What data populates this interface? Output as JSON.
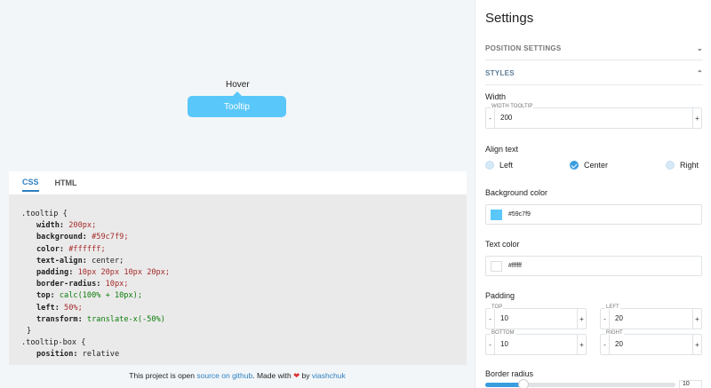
{
  "preview": {
    "hover_label": "Hover",
    "tooltip_text": "Tooltip",
    "tooltip_bg": "#59c7f9",
    "tooltip_color": "#ffffff"
  },
  "code_panel": {
    "tabs": [
      "CSS",
      "HTML"
    ],
    "active_tab": "CSS",
    "lines": [
      ".tooltip {",
      "width: 200px;",
      "background: #59c7f9;",
      "color: #ffffff;",
      "text-align: center;",
      "padding: 10px 20px 10px 20px;",
      "border-radius: 10px;",
      "top: calc(100% + 10px);",
      "left: 50%;",
      "transform: translate-x(-50%)",
      "}",
      ".tooltip-box {",
      "position: relative"
    ]
  },
  "footer": {
    "prefix": "This project is open ",
    "link1": "source on github",
    "middle": ". Made with ",
    "heart": "❤",
    "by": " by ",
    "link2": "viashchuk"
  },
  "settings": {
    "title": "Settings",
    "position_section": "POSITION SETTINGS",
    "styles_section": "STYLES",
    "width_label": "Width",
    "width_caption": "WIDTH TOOLTIP",
    "width_value": "200",
    "align_label": "Align text",
    "align_options": [
      "Left",
      "Center",
      "Right"
    ],
    "align_selected": "Center",
    "bg_label": "Background color",
    "bg_value": "#59c7f9",
    "text_color_label": "Text color",
    "text_color_value": "#ffffff",
    "padding_label": "Padding",
    "padding": {
      "top_caption": "TOP",
      "top": "10",
      "left_caption": "LEFT",
      "left": "20",
      "bottom_caption": "BOTTOM",
      "bottom": "10",
      "right_caption": "RIGHT",
      "right": "20"
    },
    "minus": "-",
    "plus": "+",
    "radius_label": "Border radius",
    "radius_value": "10",
    "radius_fraction": 0.2
  }
}
